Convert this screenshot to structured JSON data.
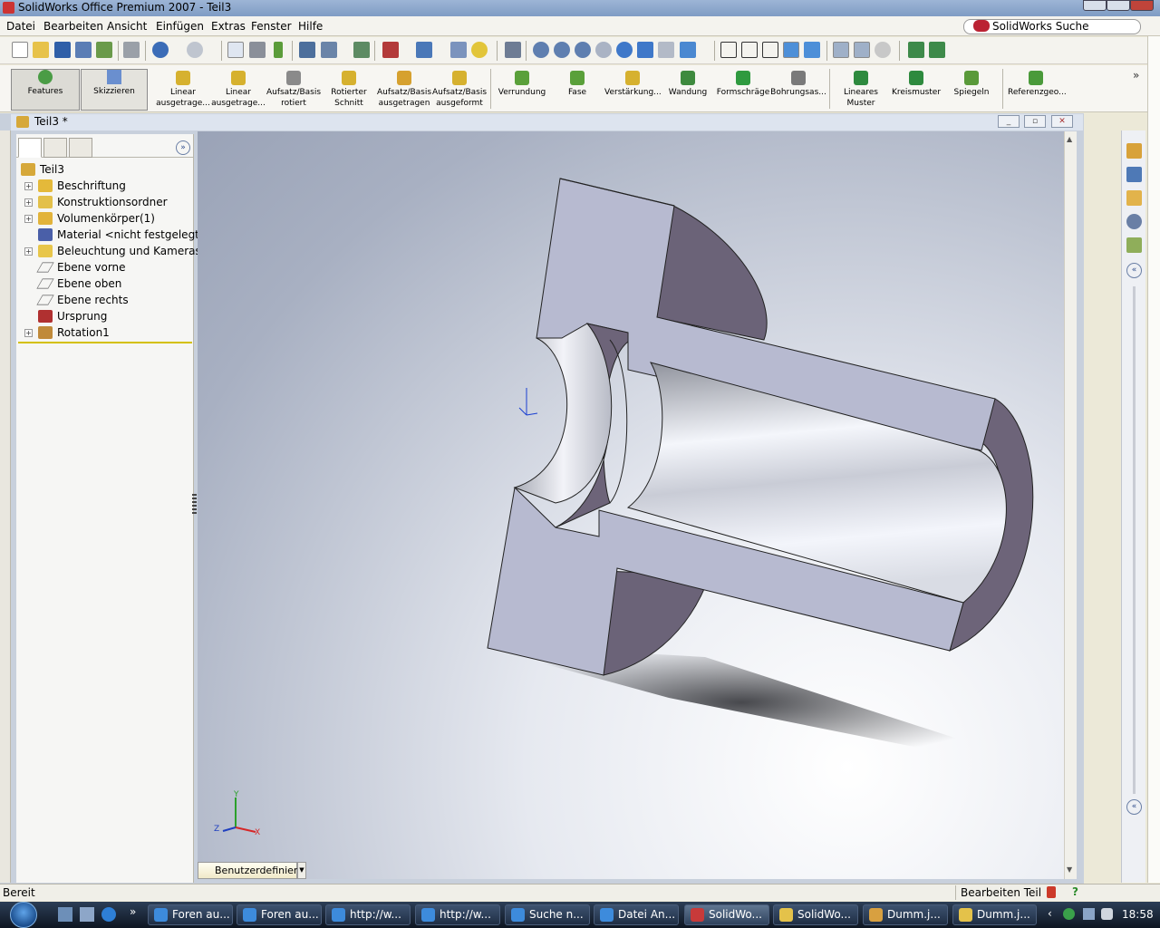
{
  "window": {
    "title": "SolidWorks Office Premium 2007 - Teil3",
    "search_label": "SolidWorks Suche"
  },
  "menu": [
    "Datei",
    "Bearbeiten",
    "Ansicht",
    "Einfügen",
    "Extras",
    "Fenster",
    "Hilfe"
  ],
  "ribbon": {
    "features": "Features",
    "sketch": "Skizzieren",
    "buttons": [
      {
        "line1": "Linear",
        "line2": "ausgetrage...",
        "icon": "extruded-boss-icon"
      },
      {
        "line1": "Linear",
        "line2": "ausgetrage...",
        "icon": "extruded-cut-icon"
      },
      {
        "line1": "Aufsatz/Basis",
        "line2": "rotiert",
        "icon": "revolve-icon"
      },
      {
        "line1": "Rotierter",
        "line2": "Schnitt",
        "icon": "revolved-cut-icon"
      },
      {
        "line1": "Aufsatz/Basis",
        "line2": "ausgetragen",
        "icon": "sweep-icon"
      },
      {
        "line1": "Aufsatz/Basis",
        "line2": "ausgeformt",
        "icon": "loft-icon"
      },
      {
        "line1": "Verrundung",
        "line2": "",
        "icon": "fillet-icon"
      },
      {
        "line1": "Fase",
        "line2": "",
        "icon": "chamfer-icon"
      },
      {
        "line1": "Verstärkung...",
        "line2": "",
        "icon": "rib-icon"
      },
      {
        "line1": "Wandung",
        "line2": "",
        "icon": "shell-icon"
      },
      {
        "line1": "Formschräge",
        "line2": "",
        "icon": "draft-icon"
      },
      {
        "line1": "Bohrungsas...",
        "line2": "",
        "icon": "hole-wizard-icon"
      },
      {
        "line1": "Lineares",
        "line2": "Muster",
        "icon": "linear-pattern-icon"
      },
      {
        "line1": "Kreismuster",
        "line2": "",
        "icon": "circular-pattern-icon"
      },
      {
        "line1": "Spiegeln",
        "line2": "",
        "icon": "mirror-icon"
      },
      {
        "line1": "Referenzgeo...",
        "line2": "",
        "icon": "reference-geometry-icon"
      }
    ]
  },
  "document": {
    "title": "Teil3 *",
    "window_buttons": [
      "minimize",
      "restore",
      "close"
    ]
  },
  "feature_tree": {
    "root": "Teil3",
    "items": [
      {
        "label": "Beschriftung",
        "expandable": true,
        "icon": "annotations-icon"
      },
      {
        "label": "Konstruktionsordner",
        "expandable": true,
        "icon": "design-binder-icon"
      },
      {
        "label": "Volumenkörper(1)",
        "expandable": true,
        "icon": "solid-bodies-icon"
      },
      {
        "label": "Material <nicht festgelegt>",
        "expandable": false,
        "icon": "material-icon"
      },
      {
        "label": "Beleuchtung und Kameras",
        "expandable": true,
        "icon": "lights-icon"
      },
      {
        "label": "Ebene vorne",
        "expandable": false,
        "icon": "plane-icon"
      },
      {
        "label": "Ebene oben",
        "expandable": false,
        "icon": "plane-icon"
      },
      {
        "label": "Ebene rechts",
        "expandable": false,
        "icon": "plane-icon"
      },
      {
        "label": "Ursprung",
        "expandable": false,
        "icon": "origin-icon"
      },
      {
        "label": "Rotation1",
        "expandable": true,
        "icon": "revolve-feature-icon"
      }
    ]
  },
  "viewport": {
    "triad": {
      "x": "X",
      "y": "Y",
      "z": "Z"
    },
    "configuration": "Benutzerdefiniert"
  },
  "status": {
    "left": "Bereit",
    "mode": "Bearbeiten Teil",
    "help": "?"
  },
  "taskbar": {
    "buttons": [
      {
        "label": "Foren au...",
        "icon": "ie-icon",
        "active": false
      },
      {
        "label": "Foren au...",
        "icon": "ie-icon",
        "active": false
      },
      {
        "label": "http://w...",
        "icon": "ie-icon",
        "active": false
      },
      {
        "label": "http://w...",
        "icon": "ie-icon",
        "active": false
      },
      {
        "label": "Suche n...",
        "icon": "ie-icon",
        "active": false
      },
      {
        "label": "Datei An...",
        "icon": "ie-icon",
        "active": false
      },
      {
        "label": "SolidWo...",
        "icon": "solidworks-icon",
        "active": true
      },
      {
        "label": "SolidWo...",
        "icon": "solidworks-help-icon",
        "active": false
      },
      {
        "label": "Dumm.j...",
        "icon": "image-editor-icon",
        "active": false
      },
      {
        "label": "Dumm.j...",
        "icon": "folder-icon",
        "active": false
      }
    ],
    "clock": "18:58"
  }
}
